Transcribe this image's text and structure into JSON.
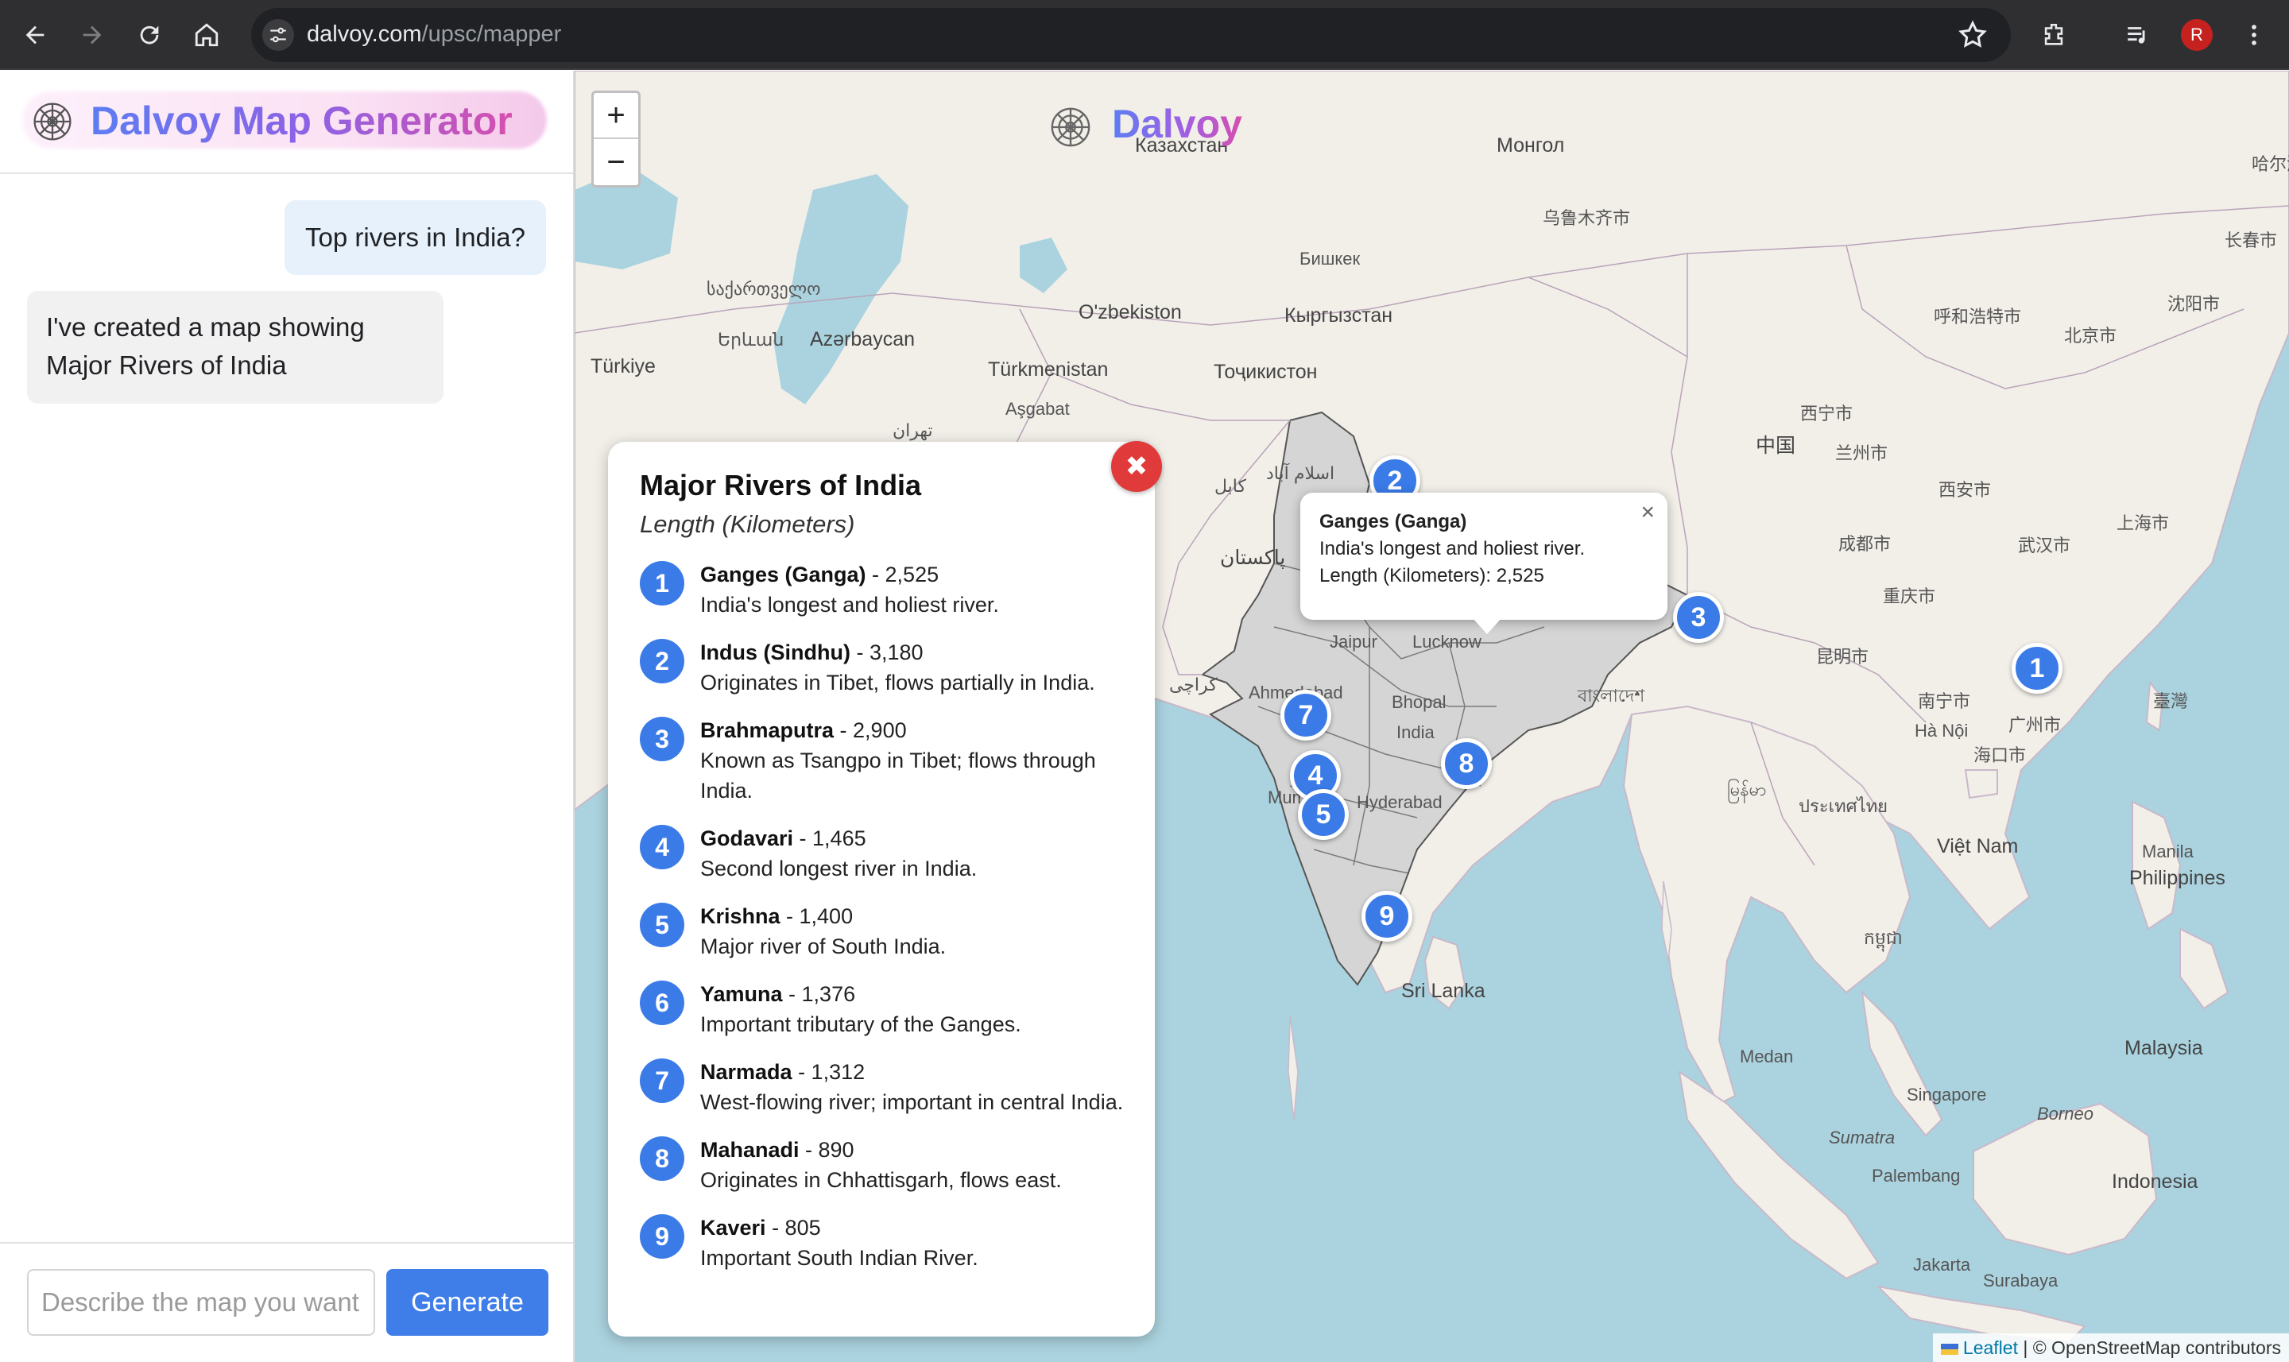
{
  "browser": {
    "url_host": "dalvoy.com",
    "url_path": "/upsc/mapper",
    "profile_initial": "R",
    "icons": [
      "back-icon",
      "forward-icon",
      "reload-icon",
      "home-icon",
      "site-settings-icon",
      "star-icon",
      "extensions-icon",
      "media-icon",
      "menu-icon"
    ]
  },
  "sidebar": {
    "title": "Dalvoy Map Generator",
    "messages": [
      {
        "role": "user",
        "text": "Top rivers in India?"
      },
      {
        "role": "assistant",
        "text": "I've created a map showing Major Rivers of India"
      }
    ],
    "input_placeholder": "Describe the map you want...",
    "generate_label": "Generate"
  },
  "map": {
    "brand": "Dalvoy",
    "zoom_in": "+",
    "zoom_out": "−",
    "labels": {
      "mongolia": "Монгол",
      "kazakhstan": "Казахстан",
      "uzbekistan": "O'zbekiston",
      "kyrgyzstan": "Кыргызстан",
      "tajikistan": "Тоҷикистон",
      "turkmenistan": "Türkmenistan",
      "ashgabat": "Aşgabat",
      "bishkek": "Бишкек",
      "urumqi": "乌鲁木齐市",
      "china": "中国",
      "georgia": "საქართველო",
      "armenia": "Երևան",
      "azerbaijan": "Azərbaycan",
      "turkiye": "Türkiye",
      "tehran": "تهران",
      "kabul": "کابل",
      "islamabad": "اسلام آباد",
      "pakistan": "پاکستان",
      "karachi": "کراچی",
      "jaipur": "Jaipur",
      "lucknow": "Lucknow",
      "bhopal": "Bhopal",
      "india": "India",
      "ahmedabad": "Ahmedabad",
      "hyderabad": "Hyderabad",
      "mumbai": "Mumbai",
      "srilanka": "Sri Lanka",
      "bangladesh": "বাংলাদেশ",
      "myanmar": "မြန်မာ",
      "thailand": "ประเทศไทย",
      "cambodia": "កម្ពុជា",
      "vietnam": "Việt Nam",
      "hanoi": "Hà Nội",
      "manila": "Manila",
      "philippines": "Philippines",
      "malaysia": "Malaysia",
      "singapore": "Singapore",
      "medan": "Medan",
      "sumatra": "Sumatra",
      "palembang": "Palembang",
      "borneo": "Borneo",
      "indonesia": "Indonesia",
      "jakarta": "Jakarta",
      "surabaya": "Surabaya",
      "beijing": "北京市",
      "shanghai": "上海市",
      "wuhan": "武汉市",
      "chengdu": "成都市",
      "chongqing": "重庆市",
      "kunming": "昆明市",
      "guangzhou": "广州市",
      "nanning": "南宁市",
      "xian": "西安市",
      "lanzhou": "兰州市",
      "xining": "西宁市",
      "taiwan": "臺灣",
      "haikou": "海口市",
      "shenyang": "沈阳市",
      "changchun": "长春市",
      "harbin": "哈尔滨市",
      "hohhot": "呼和浩特市"
    },
    "popup": {
      "title": "Ganges (Ganga)",
      "description": "India's longest and holiest river.",
      "length": "Length (Kilometers): 2,525"
    },
    "attribution_leaflet": "Leaflet",
    "attribution_rest": "| © OpenStreetMap contributors"
  },
  "legend": {
    "title": "Major Rivers of India",
    "subtitle": "Length (Kilometers)",
    "items": [
      {
        "num": "1",
        "name": "Ganges (Ganga)",
        "length": " - 2,525",
        "desc": "India's longest and holiest river."
      },
      {
        "num": "2",
        "name": "Indus (Sindhu)",
        "length": " - 3,180",
        "desc": "Originates in Tibet, flows partially in India."
      },
      {
        "num": "3",
        "name": "Brahmaputra",
        "length": " - 2,900",
        "desc": "Known as Tsangpo in Tibet; flows through India."
      },
      {
        "num": "4",
        "name": "Godavari",
        "length": " - 1,465",
        "desc": "Second longest river in India."
      },
      {
        "num": "5",
        "name": "Krishna",
        "length": " - 1,400",
        "desc": "Major river of South India."
      },
      {
        "num": "6",
        "name": "Yamuna",
        "length": " - 1,376",
        "desc": "Important tributary of the Ganges."
      },
      {
        "num": "7",
        "name": "Narmada",
        "length": " - 1,312",
        "desc": "West-flowing river; important in central India."
      },
      {
        "num": "8",
        "name": "Mahanadi",
        "length": " - 890",
        "desc": "Originates in Chhattisgarh, flows east."
      },
      {
        "num": "9",
        "name": "Kaveri",
        "length": " - 805",
        "desc": "Important South Indian River."
      }
    ]
  }
}
